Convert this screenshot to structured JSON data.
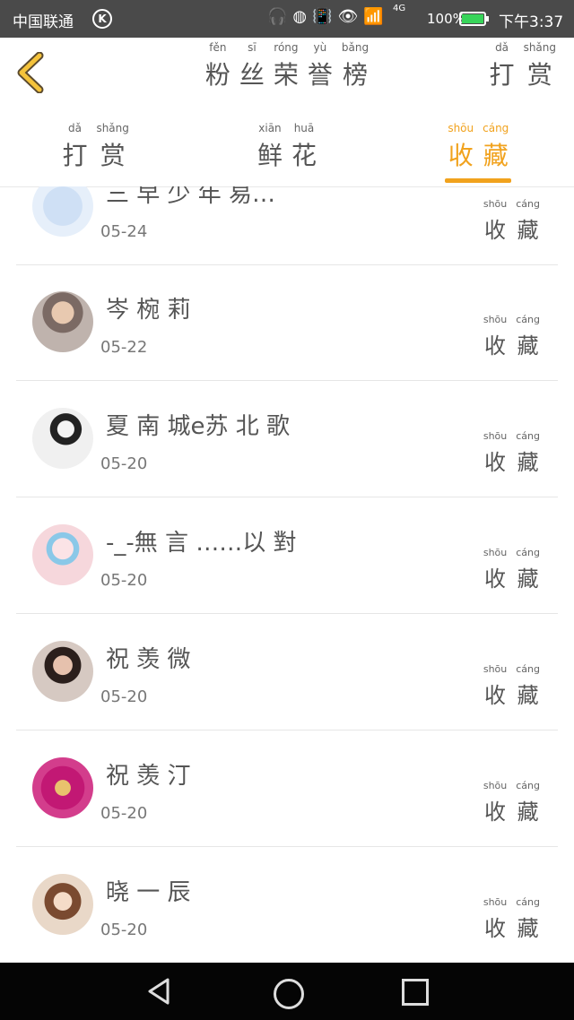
{
  "status_bar": {
    "carrier": "中国联通",
    "carrier_badge": "K",
    "network": "4G",
    "battery": "100%",
    "battery_level": 1.0,
    "time": "下午3:37"
  },
  "header": {
    "title": [
      {
        "py": "fěn",
        "hz": "粉"
      },
      {
        "py": "sī",
        "hz": "丝"
      },
      {
        "py": "róng",
        "hz": "荣"
      },
      {
        "py": "yù",
        "hz": "誉"
      },
      {
        "py": "bǎng",
        "hz": "榜"
      }
    ],
    "reward": [
      {
        "py": "dǎ",
        "hz": "打"
      },
      {
        "py": "shǎng",
        "hz": "赏"
      }
    ]
  },
  "tabs": [
    {
      "label": [
        {
          "py": "dǎ",
          "hz": "打"
        },
        {
          "py": "shǎng",
          "hz": "赏"
        }
      ],
      "active": false
    },
    {
      "label": [
        {
          "py": "xiān",
          "hz": "鲜"
        },
        {
          "py": "huā",
          "hz": "花"
        }
      ],
      "active": false
    },
    {
      "label": [
        {
          "py": "shōu",
          "hz": "收"
        },
        {
          "py": "cáng",
          "hz": "藏"
        }
      ],
      "active": true
    }
  ],
  "fav_label": [
    {
      "py": "shōu",
      "hz": "收"
    },
    {
      "py": "cáng",
      "hz": "藏"
    }
  ],
  "rows": [
    {
      "name": "三 早 少 年  易…",
      "date": "05-24",
      "avatar": "blue-logo"
    },
    {
      "name": "岑 椀 莉",
      "date": "05-22",
      "avatar": "photo-man"
    },
    {
      "name": "夏 南 城e苏 北 歌",
      "date": "05-20",
      "avatar": "sketch-girl"
    },
    {
      "name": "-_-無 言 ……以 對",
      "date": "05-20",
      "avatar": "pink-girl"
    },
    {
      "name": "祝 羡 微",
      "date": "05-20",
      "avatar": "photo-woman"
    },
    {
      "name": "祝 羡 汀",
      "date": "05-20",
      "avatar": "pink-tv"
    },
    {
      "name": "晓 一 辰",
      "date": "05-20",
      "avatar": "anime-girl"
    }
  ]
}
